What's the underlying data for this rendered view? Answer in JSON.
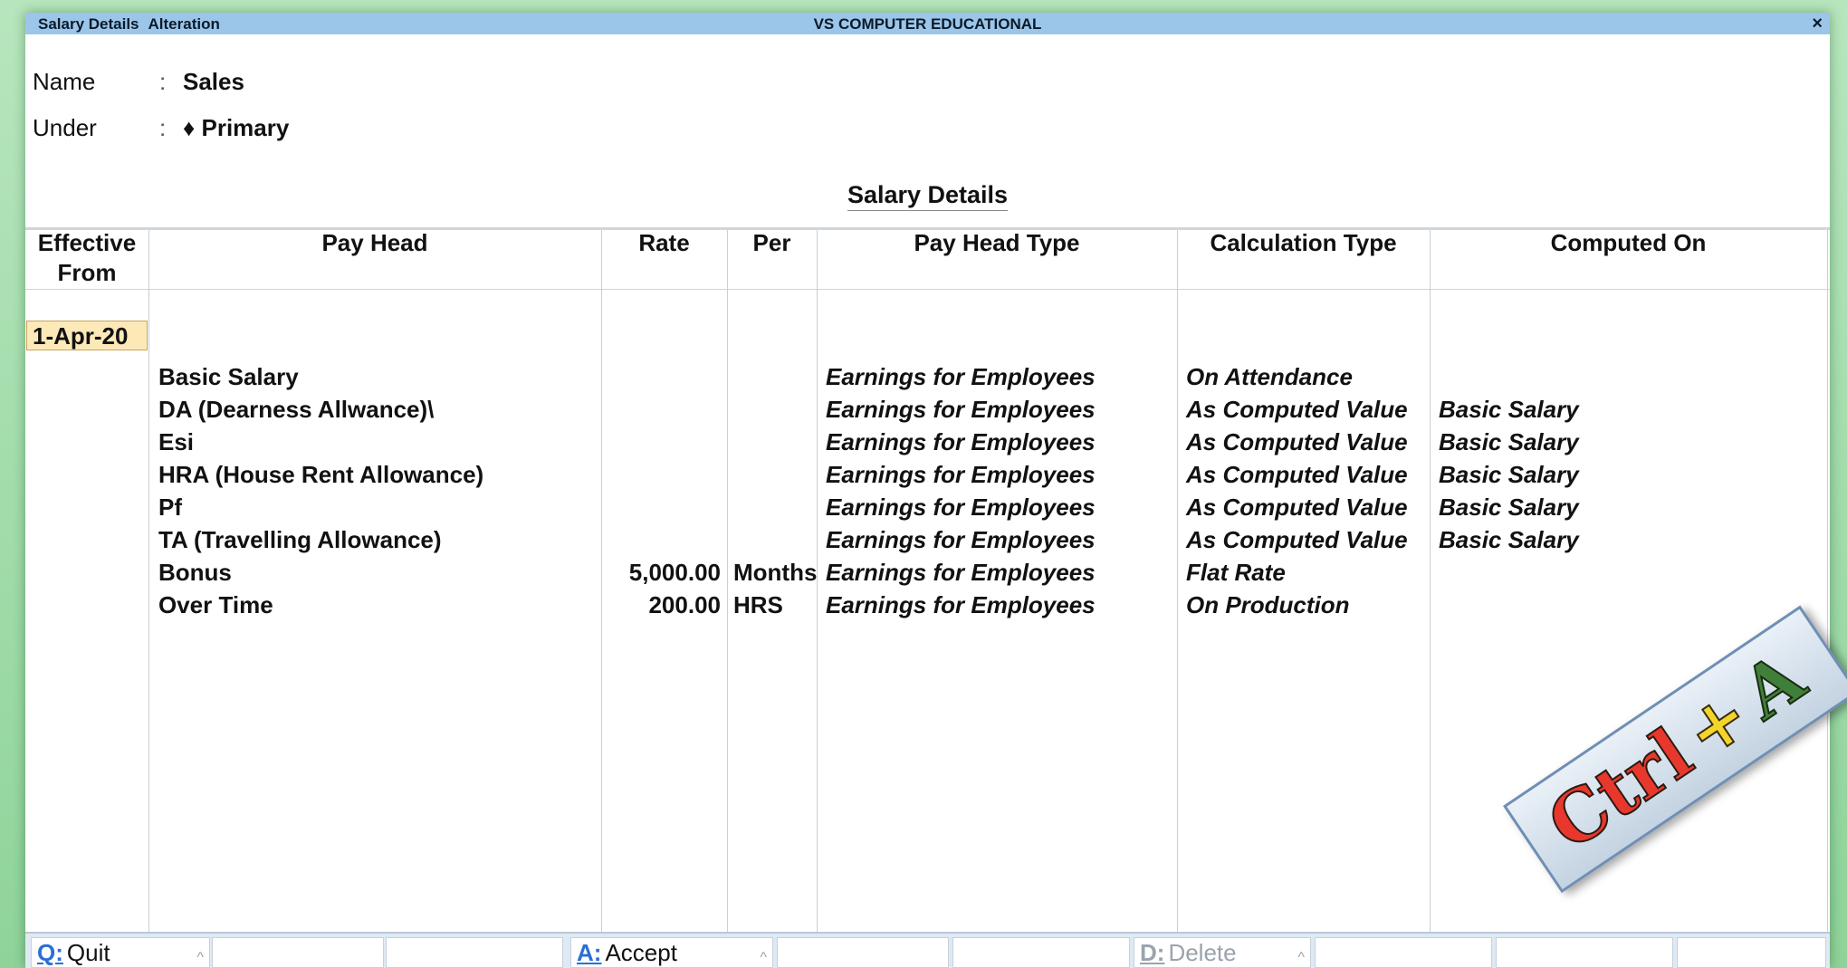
{
  "titlebar": {
    "screen": "Salary Details",
    "mode": "Alteration",
    "company": "VS COMPUTER EDUCATIONAL",
    "close": "×"
  },
  "fields": {
    "name_label": "Name",
    "name_value": "Sales",
    "under_label": "Under",
    "under_value": "♦ Primary",
    "colon": ":"
  },
  "section_title": "Salary Details",
  "columns": {
    "effective_from": "Effective From",
    "pay_head": "Pay Head",
    "rate": "Rate",
    "per": "Per",
    "pay_head_type": "Pay Head Type",
    "calculation_type": "Calculation Type",
    "computed_on": "Computed On"
  },
  "effective_from": "1-Apr-20",
  "rows": [
    {
      "pay_head": "Basic Salary",
      "rate": "",
      "per": "",
      "type": "Earnings for Employees",
      "calc": "On Attendance",
      "computed_on": ""
    },
    {
      "pay_head": "DA (Dearness Allwance)\\",
      "rate": "",
      "per": "",
      "type": "Earnings for Employees",
      "calc": "As Computed Value",
      "computed_on": "Basic Salary"
    },
    {
      "pay_head": "Esi",
      "rate": "",
      "per": "",
      "type": "Earnings for Employees",
      "calc": "As Computed Value",
      "computed_on": "Basic Salary"
    },
    {
      "pay_head": "HRA (House Rent Allowance)",
      "rate": "",
      "per": "",
      "type": "Earnings for Employees",
      "calc": "As Computed Value",
      "computed_on": "Basic Salary"
    },
    {
      "pay_head": "Pf",
      "rate": "",
      "per": "",
      "type": "Earnings for Employees",
      "calc": "As Computed Value",
      "computed_on": "Basic Salary"
    },
    {
      "pay_head": "TA (Travelling Allowance)",
      "rate": "",
      "per": "",
      "type": "Earnings for Employees",
      "calc": "As Computed Value",
      "computed_on": "Basic Salary"
    },
    {
      "pay_head": "Bonus",
      "rate": "5,000.00",
      "per": "Months",
      "type": "Earnings for Employees",
      "calc": "Flat Rate",
      "computed_on": ""
    },
    {
      "pay_head": "Over Time",
      "rate": "200.00",
      "per": "HRS",
      "type": "Earnings for Employees",
      "calc": "On Production",
      "computed_on": ""
    }
  ],
  "buttons": {
    "quit_key": "Q:",
    "quit_label": "Quit",
    "accept_key": "A:",
    "accept_label": "Accept",
    "delete_key": "D:",
    "delete_label": "Delete",
    "caret": "^"
  },
  "shortcut_badge": {
    "part1": "Ctrl",
    "part2": "+",
    "part3": "A"
  }
}
